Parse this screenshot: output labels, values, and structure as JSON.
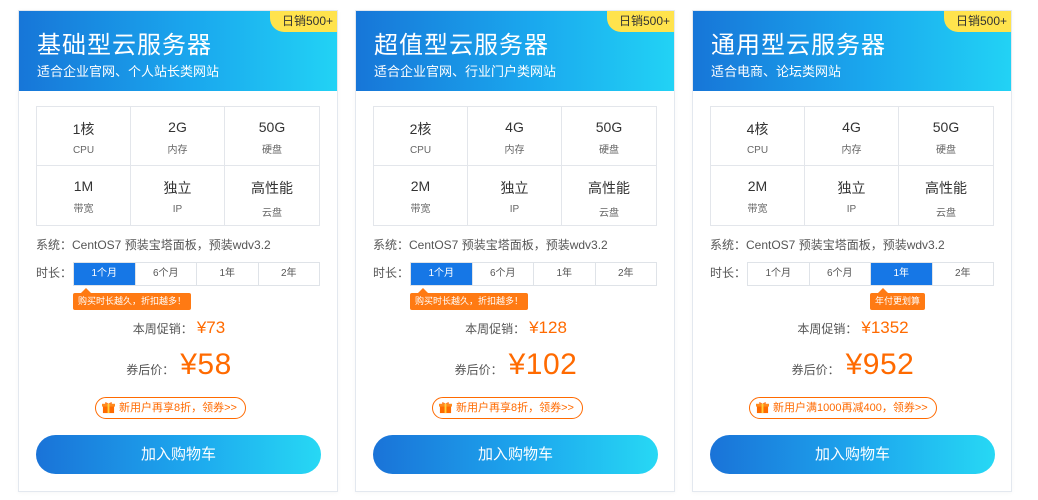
{
  "cards": [
    {
      "title": "基础型云服务器",
      "subtitle": "适合企业官网、个人站长类网站",
      "badge": "日销500+",
      "specs": [
        {
          "value": "1核",
          "label": "CPU"
        },
        {
          "value": "2G",
          "label": "内存"
        },
        {
          "value": "50G",
          "label": "硬盘"
        },
        {
          "value": "1M",
          "label": "带宽"
        },
        {
          "value": "独立",
          "label": "IP"
        },
        {
          "value": "高性能",
          "label": "云盘"
        }
      ],
      "system": "系统：CentOS7 预装宝塔面板，预装wdv3.2",
      "duration_label": "时长：",
      "durations": [
        "1个月",
        "6个月",
        "1年",
        "2年"
      ],
      "selected_duration": "1个月",
      "tip": "购买时长越久，折扣越多！",
      "promo_label": "本周促销：",
      "promo_price": "¥73",
      "after_label": "券后价：",
      "after_price": "¥58",
      "coupon": "新用户再享8折，领券>>",
      "cart_button": "加入购物车"
    },
    {
      "title": "超值型云服务器",
      "subtitle": "适合企业官网、行业门户类网站",
      "badge": "日销500+",
      "specs": [
        {
          "value": "2核",
          "label": "CPU"
        },
        {
          "value": "4G",
          "label": "内存"
        },
        {
          "value": "50G",
          "label": "硬盘"
        },
        {
          "value": "2M",
          "label": "带宽"
        },
        {
          "value": "独立",
          "label": "IP"
        },
        {
          "value": "高性能",
          "label": "云盘"
        }
      ],
      "system": "系统：CentOS7 预装宝塔面板，预装wdv3.2",
      "duration_label": "时长：",
      "durations": [
        "1个月",
        "6个月",
        "1年",
        "2年"
      ],
      "selected_duration": "1个月",
      "tip": "购买时长越久，折扣越多！",
      "promo_label": "本周促销：",
      "promo_price": "¥128",
      "after_label": "券后价：",
      "after_price": "¥102",
      "coupon": "新用户再享8折，领券>>",
      "cart_button": "加入购物车"
    },
    {
      "title": "通用型云服务器",
      "subtitle": "适合电商、论坛类网站",
      "badge": "日销500+",
      "specs": [
        {
          "value": "4核",
          "label": "CPU"
        },
        {
          "value": "4G",
          "label": "内存"
        },
        {
          "value": "50G",
          "label": "硬盘"
        },
        {
          "value": "2M",
          "label": "带宽"
        },
        {
          "value": "独立",
          "label": "IP"
        },
        {
          "value": "高性能",
          "label": "云盘"
        }
      ],
      "system": "系统：CentOS7 预装宝塔面板，预装wdv3.2",
      "duration_label": "时长：",
      "durations": [
        "1个月",
        "6个月",
        "1年",
        "2年"
      ],
      "selected_duration": "1年",
      "tip": "年付更划算",
      "promo_label": "本周促销：",
      "promo_price": "¥1352",
      "after_label": "券后价：",
      "after_price": "¥952",
      "coupon": "新用户满1000再减400，领券>>",
      "cart_button": "加入购物车"
    }
  ],
  "colors": {
    "accent": "#1677e6",
    "price": "#ff6a00",
    "badge": "#ffe34d",
    "tip": "#ff7a13"
  }
}
